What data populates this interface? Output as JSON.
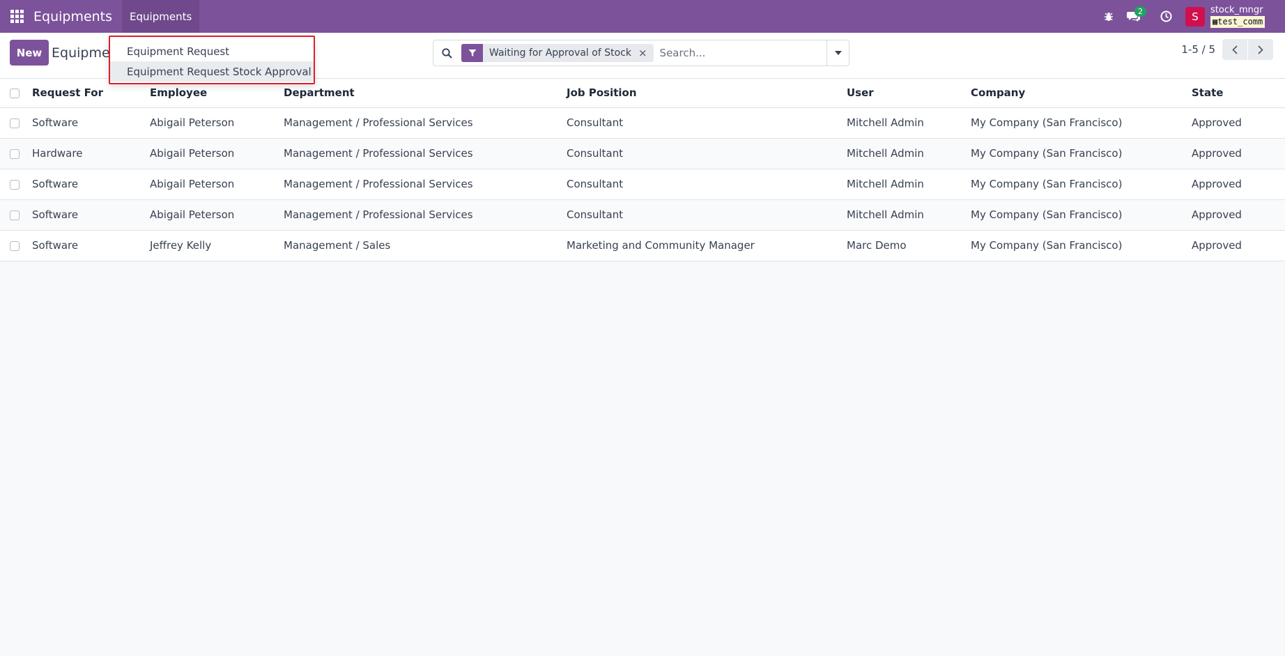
{
  "navbar": {
    "app_title": "Equipments",
    "menu_label": "Equipments",
    "chat_count": "2",
    "avatar_letter": "S",
    "user_name": "stock_mngr",
    "db_name": "test_comm"
  },
  "control_panel": {
    "new_label": "New",
    "breadcrumb": "Equipmen",
    "search": {
      "facet": "Waiting for Approval of Stock",
      "facet_remove": "×",
      "placeholder": "Search..."
    },
    "pager": "1-5 / 5"
  },
  "dropdown": {
    "items": [
      {
        "label": "Equipment Request"
      },
      {
        "label": "Equipment Request Stock Approval"
      }
    ]
  },
  "table": {
    "headers": {
      "request_for": "Request For",
      "employee": "Employee",
      "department": "Department",
      "job_position": "Job Position",
      "user": "User",
      "company": "Company",
      "state": "State"
    },
    "rows": [
      {
        "request_for": "Software",
        "employee": "Abigail Peterson",
        "department": "Management / Professional Services",
        "job_position": "Consultant",
        "user": "Mitchell Admin",
        "company": "My Company (San Francisco)",
        "state": "Approved"
      },
      {
        "request_for": "Hardware",
        "employee": "Abigail Peterson",
        "department": "Management / Professional Services",
        "job_position": "Consultant",
        "user": "Mitchell Admin",
        "company": "My Company (San Francisco)",
        "state": "Approved"
      },
      {
        "request_for": "Software",
        "employee": "Abigail Peterson",
        "department": "Management / Professional Services",
        "job_position": "Consultant",
        "user": "Mitchell Admin",
        "company": "My Company (San Francisco)",
        "state": "Approved"
      },
      {
        "request_for": "Software",
        "employee": "Abigail Peterson",
        "department": "Management / Professional Services",
        "job_position": "Consultant",
        "user": "Mitchell Admin",
        "company": "My Company (San Francisco)",
        "state": "Approved"
      },
      {
        "request_for": "Software",
        "employee": "Jeffrey Kelly",
        "department": "Management / Sales",
        "job_position": "Marketing and Community Manager",
        "user": "Marc Demo",
        "company": "My Company (San Francisco)",
        "state": "Approved"
      }
    ]
  },
  "colors": {
    "brand": "#7c529b",
    "highlight_border": "#e11d2a",
    "badge": "#1fa361",
    "avatar": "#d0104c"
  },
  "icons": [
    "apps-grid-icon",
    "bug-icon",
    "chat-icon",
    "clock-icon",
    "search-icon",
    "filter-icon",
    "close-icon",
    "caret-down-icon",
    "chevron-left-icon",
    "chevron-right-icon",
    "database-icon"
  ]
}
